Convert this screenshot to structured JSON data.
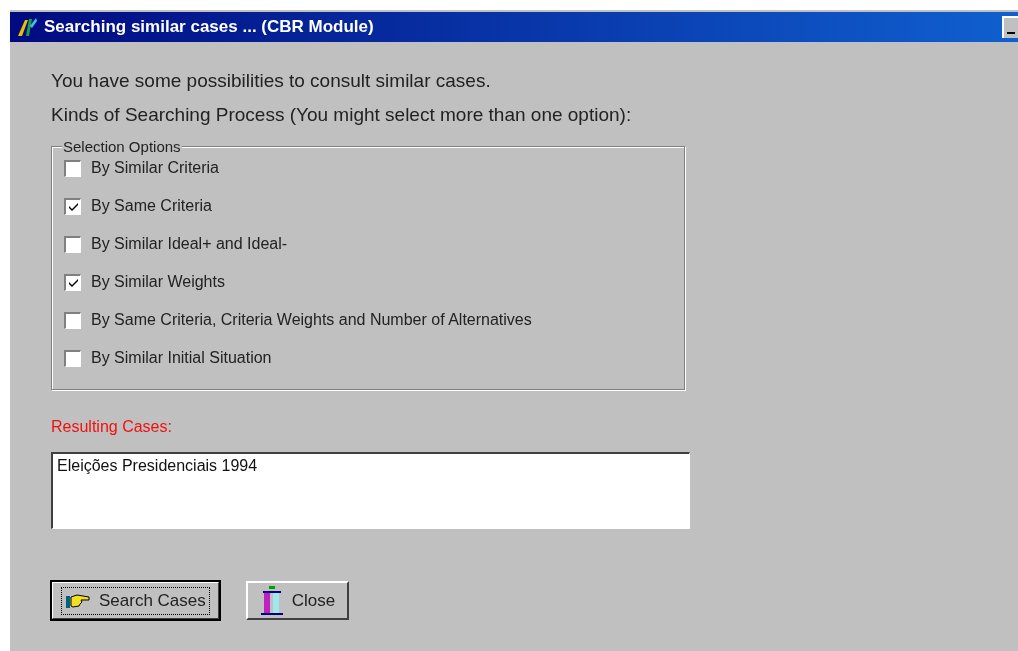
{
  "window": {
    "title": "Searching similar cases ... (CBR Module)"
  },
  "intro": [
    "You have some possibilities to consult similar cases.",
    "Kinds of Searching Process (You might select more than one option):"
  ],
  "selection_options": {
    "title": "Selection Options",
    "options": [
      {
        "label": "By Similar Criteria",
        "checked": false
      },
      {
        "label": "By Same Criteria",
        "checked": true
      },
      {
        "label": "By Similar Ideal+ and Ideal-",
        "checked": false
      },
      {
        "label": "By Similar Weights",
        "checked": true
      },
      {
        "label": "By Same Criteria, Criteria Weights and Number of Alternatives",
        "checked": false
      },
      {
        "label": "By Similar Initial Situation",
        "checked": false
      }
    ]
  },
  "results": {
    "label": "Resulting Cases:",
    "items": [
      "Eleições Presidenciais 1994"
    ]
  },
  "buttons": [
    {
      "label": "Search Cases",
      "kind": "search",
      "default": true
    },
    {
      "label": "Close",
      "kind": "close",
      "default": false
    }
  ]
}
